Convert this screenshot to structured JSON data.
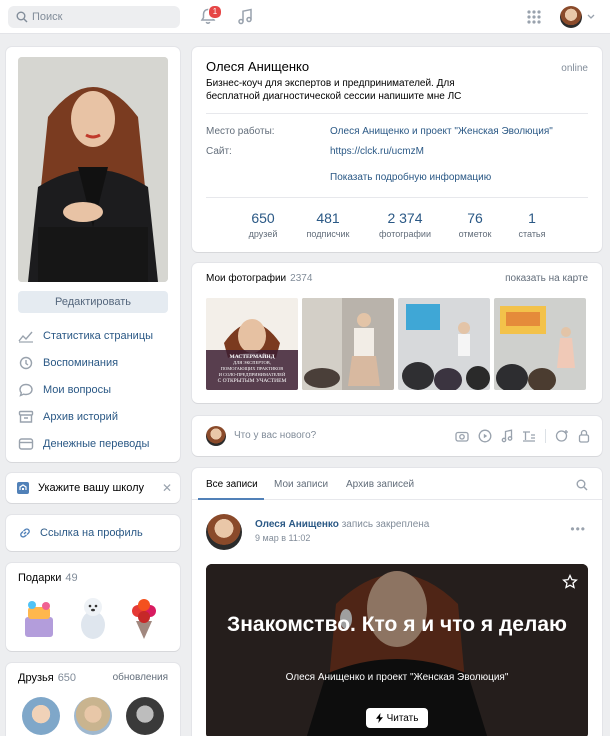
{
  "header": {
    "search_placeholder": "Поиск",
    "notifications_count": "1"
  },
  "sidebar": {
    "edit_button": "Редактировать",
    "menu": [
      {
        "label": "Статистика страницы",
        "icon": "chart-icon"
      },
      {
        "label": "Воспоминания",
        "icon": "history-icon"
      },
      {
        "label": "Мои вопросы",
        "icon": "question-icon"
      },
      {
        "label": "Архив историй",
        "icon": "archive-icon"
      },
      {
        "label": "Денежные переводы",
        "icon": "money-transfer-icon"
      }
    ],
    "school_label": "Укажите вашу школу",
    "profile_link_label": "Ссылка на профиль",
    "gifts": {
      "title": "Подарки",
      "count": "49"
    },
    "friends": {
      "title": "Друзья",
      "count": "650",
      "updates": "обновления"
    }
  },
  "profile": {
    "name": "Олеся Анищенко",
    "online": "online",
    "status": "Бизнес-коуч для экспертов и предпринимателей. Для бесплатной диагностической сессии напишите мне ЛС",
    "work_label": "Место работы:",
    "work_value": "Олеся Анищенко и проект \"Женская Эволюция\"",
    "site_label": "Сайт:",
    "site_value": "https://clck.ru/ucmzM",
    "more_info": "Показать подробную информацию",
    "stats": [
      {
        "value": "650",
        "label": "друзей"
      },
      {
        "value": "481",
        "label": "подписчик"
      },
      {
        "value": "2 374",
        "label": "фотографии"
      },
      {
        "value": "76",
        "label": "отметок"
      },
      {
        "value": "1",
        "label": "статья"
      }
    ]
  },
  "photos": {
    "title": "Мои фотографии",
    "count": "2374",
    "map_link": "показать на карте",
    "first_caption_lines": [
      "МАСТЕРМАЙНД",
      "ДЛЯ ЭКСПЕРТОВ,",
      "ПОМОГАЮЩИХ ПРАКТИКОВ",
      "И СОЛО-ПРЕДПРИНИМАТЕЛЕЙ",
      "С ОТКРЫТЫМ УЧАСТИЕМ"
    ]
  },
  "composer": {
    "placeholder": "Что у вас нового?"
  },
  "feed": {
    "tabs": [
      "Все записи",
      "Мои записи",
      "Архив записей"
    ],
    "post": {
      "author": "Олеся Анищенко",
      "action": "запись закреплена",
      "date": "9 мар в 11:02",
      "article_title": "Знакомство. Кто я и что я делаю",
      "article_subtitle": "Олеся Анищенко и проект \"Женская Эволюция\"",
      "read_button": "Читать"
    }
  }
}
